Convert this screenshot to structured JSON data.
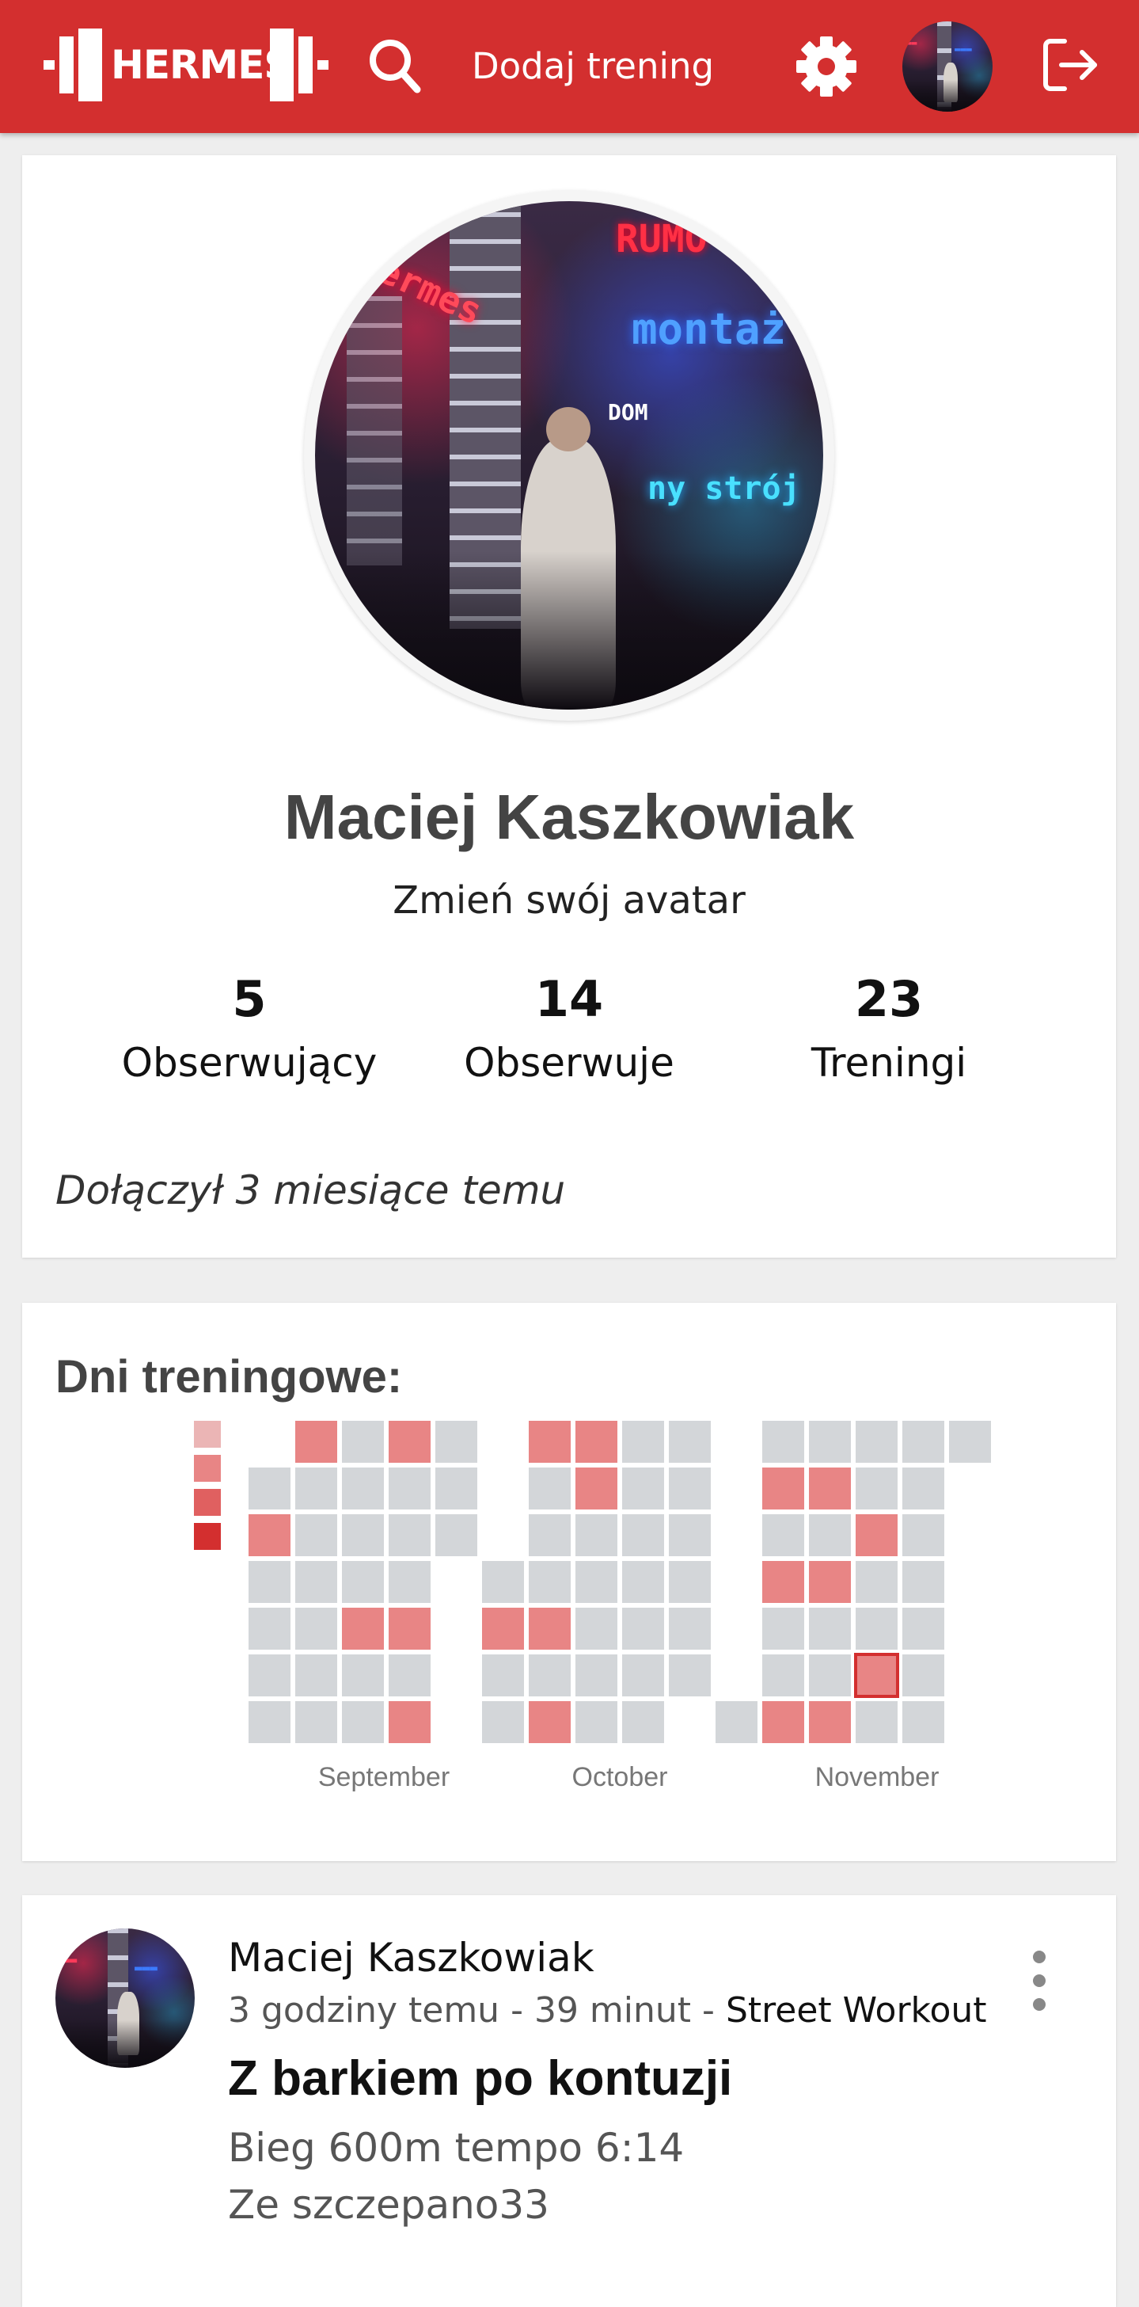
{
  "header": {
    "logo_text": "HERMES",
    "add_training_label": "Dodaj trening",
    "icons": [
      "search-icon",
      "gear-icon",
      "avatar",
      "logout-icon"
    ]
  },
  "profile": {
    "name": "Maciej Kaszkowiak",
    "change_avatar_label": "Zmień swój avatar",
    "stats": [
      {
        "value": "5",
        "label": "Obserwujący"
      },
      {
        "value": "14",
        "label": "Obserwuje"
      },
      {
        "value": "23",
        "label": "Treningi"
      }
    ],
    "joined": "Dołączył 3 miesiące temu"
  },
  "calendar": {
    "title": "Dni treningowe:",
    "months": [
      "September",
      "October",
      "November"
    ],
    "colors": {
      "empty": "#d3d6d9",
      "active": "#e88585",
      "legend": [
        "#ebb5b5",
        "#e88585",
        "#e06060",
        "#d32f2f"
      ],
      "today_border": "#d32f2f"
    },
    "columns": [
      [
        "",
        "",
        "",
        "",
        "",
        "",
        ""
      ],
      [
        null,
        "e",
        "a",
        "e",
        "e",
        "e",
        "e"
      ],
      [
        "a",
        "e",
        "e",
        "e",
        "e",
        "e",
        "e"
      ],
      [
        "e",
        "e",
        "e",
        "e",
        "a",
        "e",
        "e"
      ],
      [
        "a",
        "e",
        "e",
        "e",
        "a",
        "e",
        "a"
      ],
      [
        "e",
        "e",
        "e",
        null,
        null,
        null,
        null
      ],
      [
        null,
        null,
        null,
        "e",
        "a",
        "e",
        "e"
      ],
      [
        "a",
        "e",
        "e",
        "e",
        "a",
        "e",
        "a"
      ],
      [
        "a",
        "a",
        "e",
        "e",
        "e",
        "e",
        "e"
      ],
      [
        "e",
        "e",
        "e",
        "e",
        "e",
        "e",
        "e"
      ],
      [
        "e",
        "e",
        "e",
        "e",
        "e",
        "e",
        null
      ],
      [
        null,
        null,
        null,
        null,
        null,
        null,
        "e"
      ],
      [
        "e",
        "a",
        "e",
        "a",
        "e",
        "e",
        "a"
      ],
      [
        "e",
        "a",
        "e",
        "a",
        "e",
        "e",
        "a"
      ],
      [
        "e",
        "e",
        "a",
        "e",
        "e",
        "t",
        "e"
      ],
      [
        "e",
        "e",
        "e",
        "e",
        "e",
        "e",
        "e"
      ],
      [
        "e",
        null,
        null,
        null,
        null,
        null,
        null
      ]
    ]
  },
  "post": {
    "author": "Maciej Kaszkowiak",
    "time": "3 godziny temu",
    "duration": "39 minut",
    "separator": "-",
    "sport": "Street Workout",
    "title": "Z barkiem po kontuzji",
    "lines": [
      "Bieg 600m tempo 6:14",
      "Ze szczepano33"
    ]
  },
  "avatar_neon": {
    "a": "montaż",
    "b": "Hermes",
    "c": "ny strój",
    "d": "DOM",
    "e": "RUMO"
  }
}
